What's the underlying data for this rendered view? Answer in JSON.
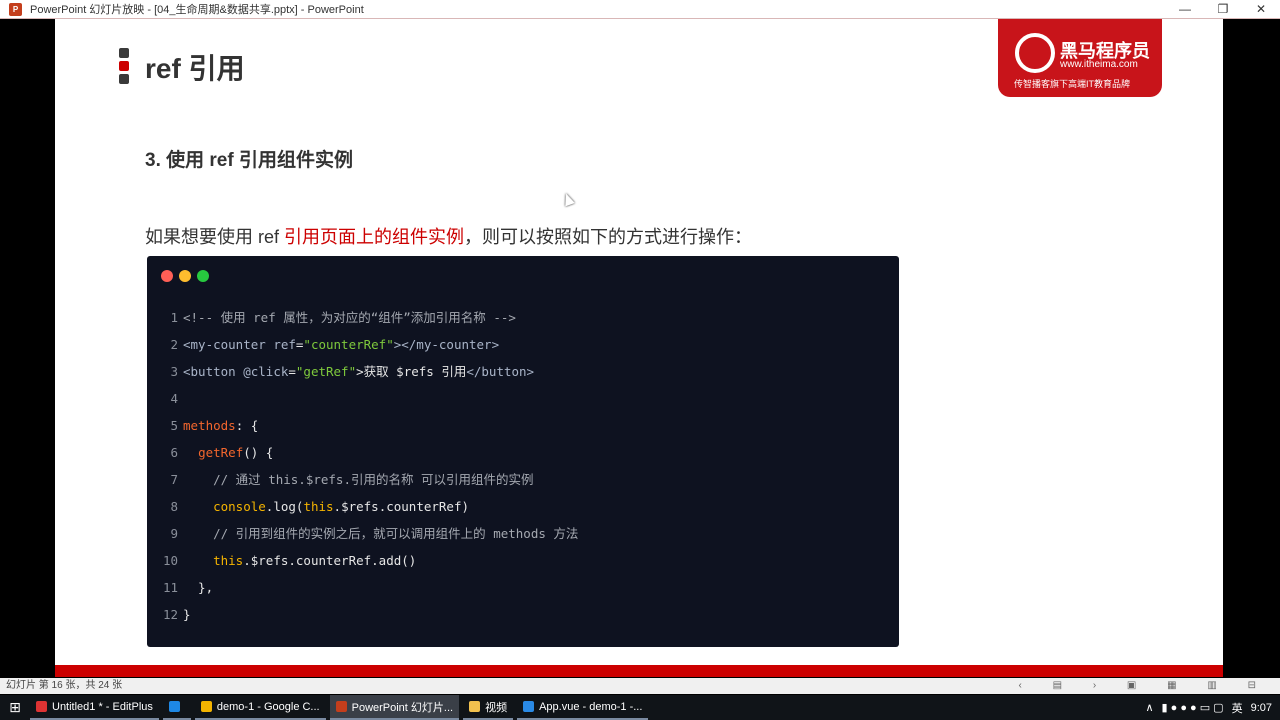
{
  "window": {
    "title": "PowerPoint 幻灯片放映 - [04_生命周期&数据共享.pptx] - PowerPoint",
    "app_icon": "P"
  },
  "slide": {
    "title": "ref 引用",
    "logo": {
      "name": "黑马程序员",
      "url": "www.itheima.com",
      "slogan": "传智播客旗下高端IT教育品牌"
    },
    "subtitle": "3. 使用 ref 引用组件实例",
    "desc": {
      "before": "如果想要使用 ref ",
      "highlight": "引用页面上的组件实例",
      "after": "，则可以按照如下的方式进行操作："
    },
    "code": [
      [
        [
          "<!-- 使用 ref 属性，为对应的“组件”添加引用名称 -->",
          "c"
        ]
      ],
      [
        [
          "<my-counter ",
          "tag"
        ],
        [
          "ref",
          "tag"
        ],
        [
          "=",
          ""
        ],
        [
          "\"counterRef\"",
          "s"
        ],
        [
          "></my-counter>",
          "tag"
        ]
      ],
      [
        [
          "<button ",
          "tag"
        ],
        [
          "@click",
          "tag"
        ],
        [
          "=",
          ""
        ],
        [
          "\"getRef\"",
          "s"
        ],
        [
          ">获取 $refs 引用",
          ""
        ],
        [
          "</button>",
          "tag"
        ]
      ],
      [],
      [
        [
          "methods",
          "k"
        ],
        [
          ": {",
          ""
        ]
      ],
      [
        [
          "  ",
          ""
        ],
        [
          "getRef",
          "k"
        ],
        [
          "() {",
          ""
        ]
      ],
      [
        [
          "    // 通过 this.$refs.引用的名称 可以引用组件的实例",
          "c"
        ]
      ],
      [
        [
          "    ",
          ""
        ],
        [
          "console",
          "y"
        ],
        [
          ".log(",
          ""
        ],
        [
          "this",
          "y"
        ],
        [
          ".$refs.counterRef)",
          ""
        ]
      ],
      [
        [
          "    // 引用到组件的实例之后，就可以调用组件上的 methods 方法",
          "c"
        ]
      ],
      [
        [
          "    ",
          ""
        ],
        [
          "this",
          "y"
        ],
        [
          ".$refs.counterRef.add()",
          ""
        ]
      ],
      [
        [
          "  },",
          ""
        ]
      ],
      [
        [
          "}",
          ""
        ]
      ]
    ]
  },
  "statusbar": {
    "slide_info": "幻灯片 第 16 张，共 24 张",
    "controls": "‹ ▤ › ▣ ▦ ▥ ⊟"
  },
  "taskbar": {
    "items": [
      {
        "label": "Untitled1 * - EditPlus",
        "color": "#d33"
      },
      {
        "label": "",
        "color": "#1e88e5"
      },
      {
        "label": "demo-1 - Google C...",
        "color": "#f4b400"
      },
      {
        "label": "PowerPoint 幻灯片...",
        "color": "#c43e1c",
        "active": true
      },
      {
        "label": "视频",
        "color": "#f2c14e"
      },
      {
        "label": "App.vue - demo-1 -...",
        "color": "#2a8ae5"
      }
    ],
    "tray": {
      "ime": "英",
      "time": "9:07"
    }
  }
}
